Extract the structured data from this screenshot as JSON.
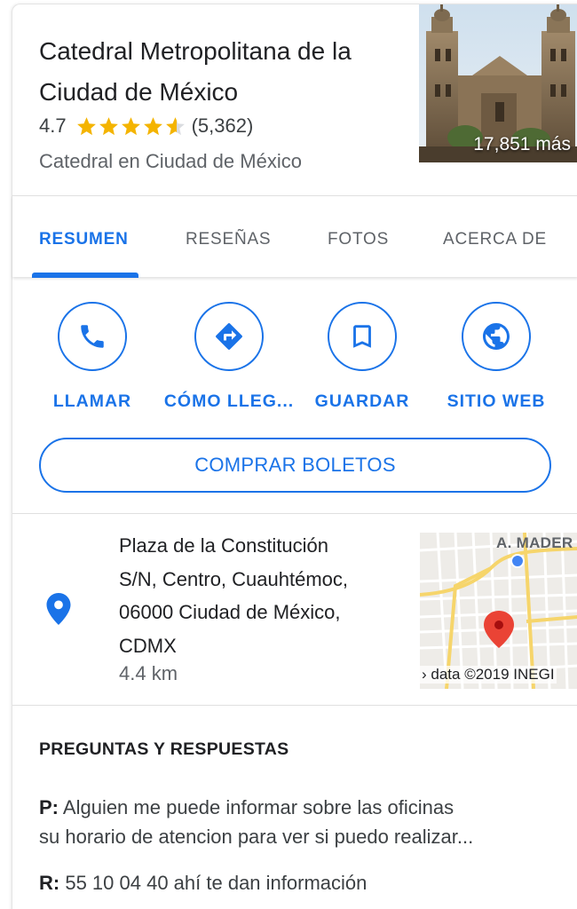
{
  "place": {
    "title": "Catedral Metropolitana de la Ciudad de México",
    "rating": "4.7",
    "rating_stars": 4.7,
    "reviews_count": "(5,362)",
    "category": "Catedral en Ciudad de México",
    "photo_count": "17,851 más"
  },
  "tabs": [
    {
      "label": "RESUMEN",
      "active": true
    },
    {
      "label": "RESEÑAS",
      "active": false
    },
    {
      "label": "FOTOS",
      "active": false
    },
    {
      "label": "ACERCA DE",
      "active": false
    }
  ],
  "actions": [
    {
      "label": "LLAMAR",
      "icon": "phone-icon"
    },
    {
      "label": "CÓMO LLEG...",
      "icon": "directions-icon"
    },
    {
      "label": "GUARDAR",
      "icon": "bookmark-icon"
    },
    {
      "label": "SITIO WEB",
      "icon": "globe-icon"
    }
  ],
  "buy_button": "COMPRAR BOLETOS",
  "address": {
    "line1": "Plaza de la Constitución",
    "line2": "S/N, Centro, Cuauhtémoc,",
    "line3": "06000 Ciudad de México,",
    "line4": "CDMX",
    "distance": "4.4 km",
    "map_label": "A. MADER",
    "map_credit": "› data ©2019 INEGI"
  },
  "qa": {
    "title": "PREGUNTAS Y RESPUESTAS",
    "q_prefix": "P:",
    "q_line1": "Alguien me puede informar sobre las oficinas",
    "q_line2": "su horario de atencion para ver si puedo realizar...",
    "a_prefix": "R:",
    "a_text": "55 10 04 40 ahí te dan información"
  },
  "colors": {
    "accent": "#1a73e8",
    "star": "#f4b400",
    "pin": "#1a73e8",
    "map_pin": "#ea4335"
  }
}
